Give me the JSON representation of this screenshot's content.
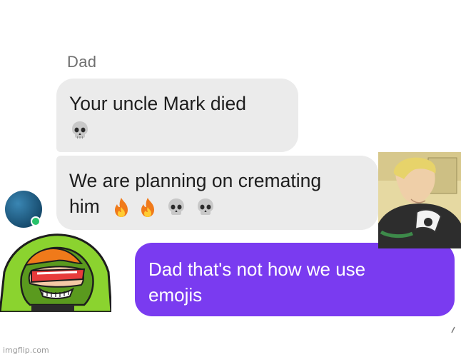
{
  "chat": {
    "sender_name": "Dad",
    "messages": [
      {
        "from": "Dad",
        "lines": [
          "Your uncle Mark died"
        ],
        "emojis": [
          "skull"
        ]
      },
      {
        "from": "Dad",
        "lines": [
          "We are planning on cremating",
          "him"
        ],
        "emojis": [
          "fire",
          "fire",
          "skull",
          "skull"
        ]
      },
      {
        "from": "me",
        "lines": [
          "Dad that's not how we use",
          "emojis"
        ]
      }
    ]
  },
  "colors": {
    "incoming_bubble": "#ebebeb",
    "outgoing_bubble": "#7a3bf0",
    "sender_name": "#6f6f6f",
    "avatar": "#1f5f86",
    "online_dot": "#27c26a"
  },
  "icons": [
    "skull-emoji",
    "fire-emoji",
    "avatar-icon"
  ],
  "watermark": "imgflip.com"
}
